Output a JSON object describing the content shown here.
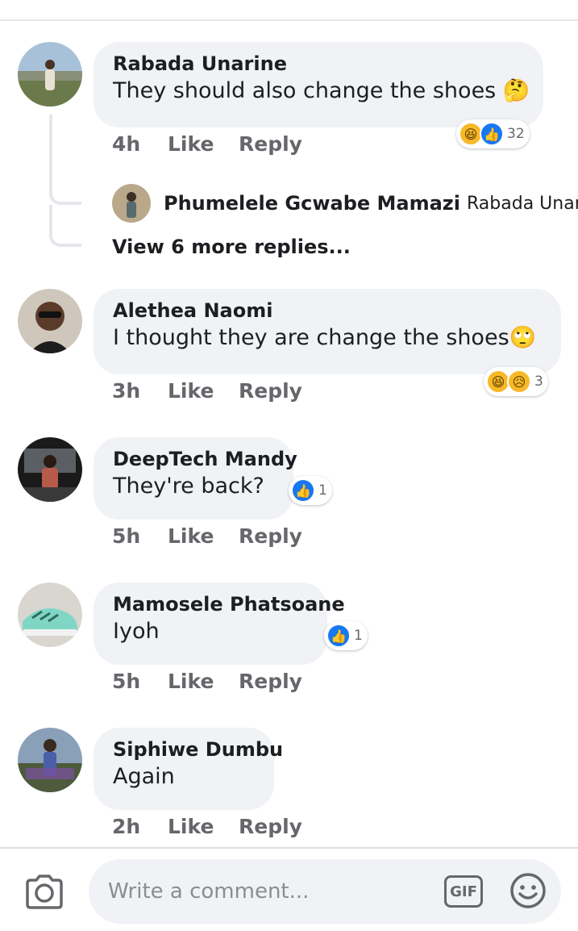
{
  "comments": [
    {
      "author": "Rabada Unarine",
      "text": "They should also change the shoes 🤔",
      "time": "4h",
      "like_label": "Like",
      "reply_label": "Reply",
      "reactions": {
        "icons": [
          "haha",
          "like"
        ],
        "count": "32"
      },
      "avatar_icon": "avatar-photo"
    },
    {
      "author": "Alethea Naomi",
      "text": "I thought they are change the shoes🙄",
      "time": "3h",
      "like_label": "Like",
      "reply_label": "Reply",
      "reactions": {
        "icons": [
          "haha",
          "sad"
        ],
        "count": "3"
      },
      "avatar_icon": "avatar-photo"
    },
    {
      "author": "DeepTech Mandy",
      "text": "They're back?",
      "time": "5h",
      "like_label": "Like",
      "reply_label": "Reply",
      "reactions": {
        "icons": [
          "like"
        ],
        "count": "1"
      },
      "avatar_icon": "avatar-photo"
    },
    {
      "author": "Mamosele Phatsoane",
      "text": "Iyoh",
      "time": "5h",
      "like_label": "Like",
      "reply_label": "Reply",
      "reactions": {
        "icons": [
          "like"
        ],
        "count": "1"
      },
      "avatar_icon": "avatar-photo"
    },
    {
      "author": "Siphiwe Dumbu",
      "text": "Again",
      "time": "2h",
      "like_label": "Like",
      "reply_label": "Reply",
      "avatar_icon": "avatar-photo"
    }
  ],
  "reply_preview": {
    "author": "Phumelele Gcwabe Mamazi",
    "snippet": "Rabada Unar..."
  },
  "view_more_replies": "View 6 more replies...",
  "footer": {
    "placeholder": "Write a comment...",
    "gif_label": "GIF",
    "icons": [
      "camera-icon",
      "gif-icon",
      "emoji-icon"
    ]
  },
  "colors": {
    "bubble": "#f0f2f5",
    "like_blue": "#1877f2",
    "haha_yellow": "#f7b928",
    "meta_gray": "#65676b"
  }
}
